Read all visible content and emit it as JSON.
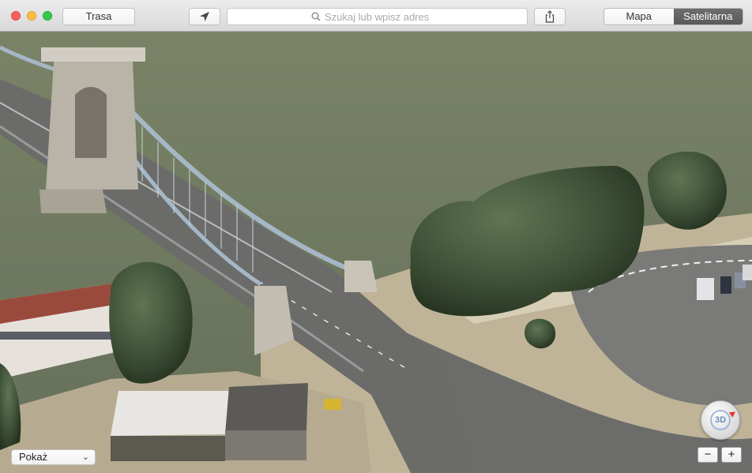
{
  "toolbar": {
    "route_label": "Trasa",
    "search_placeholder": "Szukaj lub wpisz adres",
    "view_modes": [
      "Mapa",
      "Satelitarna"
    ],
    "active_view": "Satelitarna"
  },
  "map": {
    "show_label": "Pokaż",
    "compass_label": "3D",
    "zoom_out_label": "−",
    "zoom_in_label": "+"
  },
  "colors": {
    "river": "#6c7660",
    "road": "#6e6e6e",
    "pavement": "#c9bfa9",
    "tree": "#3d5236",
    "active_segment": "#5f5f5f"
  }
}
